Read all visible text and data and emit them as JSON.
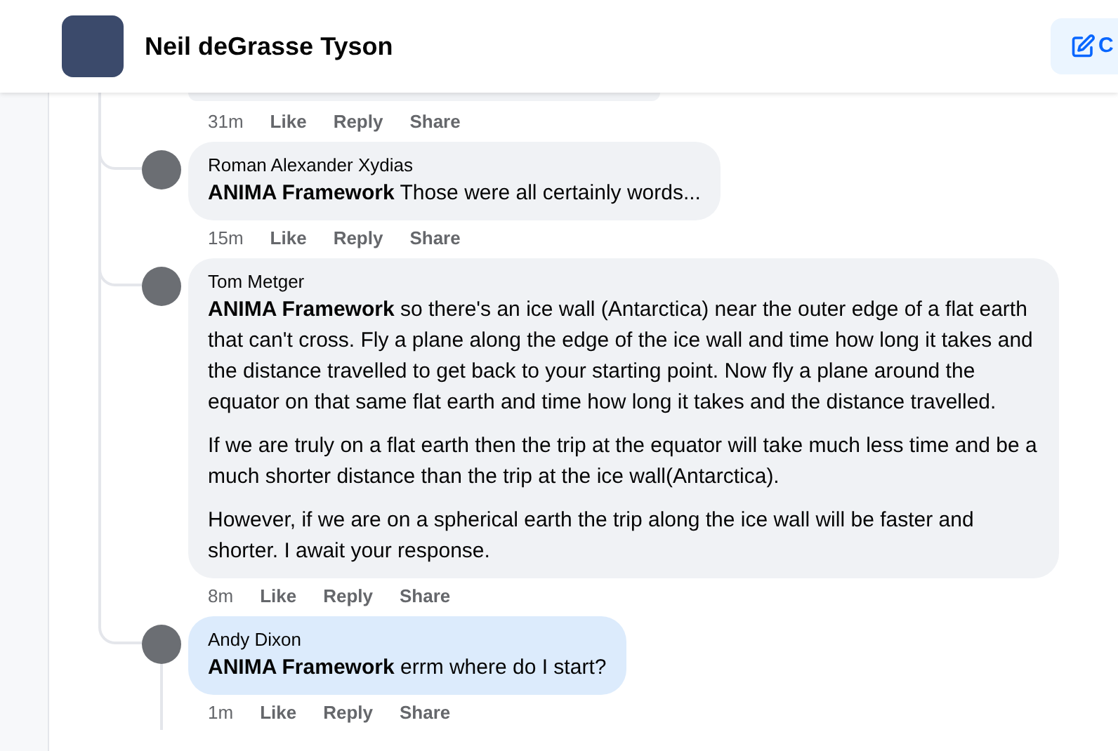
{
  "header": {
    "name": "Neil deGrasse Tyson",
    "button": {
      "label": "C"
    }
  },
  "comments": [
    {
      "kind": "cut",
      "time": "31m",
      "actions": [
        "Like",
        "Reply",
        "Share"
      ]
    },
    {
      "kind": "full",
      "author": "Roman Alexander Xydias",
      "paragraphs": [
        "**ANIMA Framework** Those were all certainly words..."
      ],
      "time": "15m",
      "actions": [
        "Like",
        "Reply",
        "Share"
      ],
      "highlighted": false,
      "has_replies": false
    },
    {
      "kind": "full",
      "author": "Tom Metger",
      "paragraphs": [
        "**ANIMA Framework** so there's an ice wall (Antarctica) near the outer edge of a flat earth that can't cross. Fly a plane along the edge of the ice wall and time how long it takes and the distance travelled to get back to your starting point. Now fly a plane around the equator on that same flat earth and time how long it takes and the distance travelled.",
        "If we are truly on a flat earth then the trip at the equator will take much less time and be a much shorter distance than the trip at the ice wall(Antarctica).",
        "However, if we are on a spherical earth the trip along the ice wall will be faster and shorter. I await your response."
      ],
      "time": "8m",
      "actions": [
        "Like",
        "Reply",
        "Share"
      ],
      "highlighted": false,
      "has_replies": false
    },
    {
      "kind": "full",
      "author": "Andy Dixon",
      "paragraphs": [
        "**ANIMA Framework** errm where do I start?"
      ],
      "time": "1m",
      "actions": [
        "Like",
        "Reply",
        "Share"
      ],
      "highlighted": true,
      "has_replies": true
    }
  ]
}
